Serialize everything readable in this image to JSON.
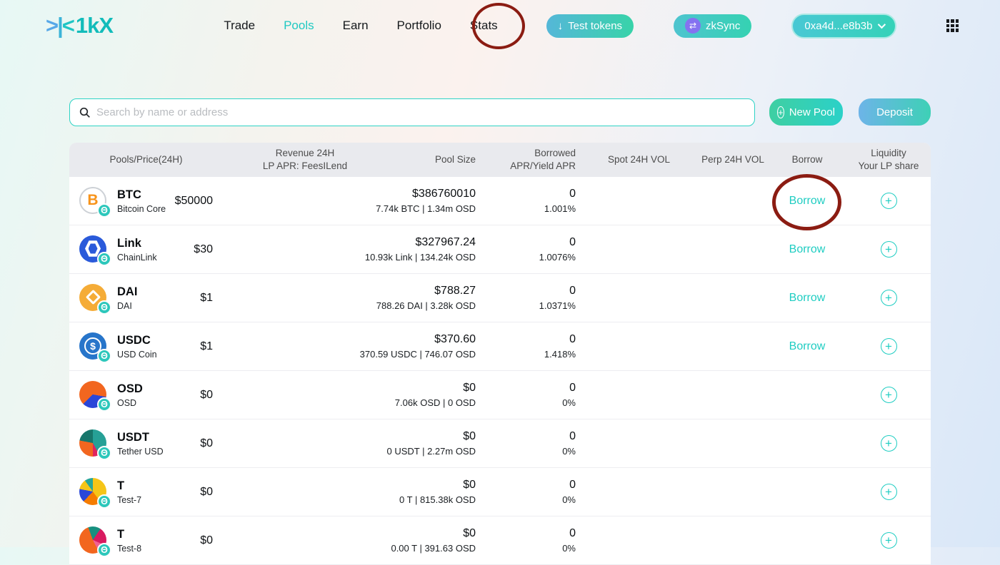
{
  "brand": {
    "mark_1": ">",
    "mark_2": "|",
    "mark_3": "<",
    "name": "1kX"
  },
  "nav": {
    "items": [
      {
        "label": "Trade"
      },
      {
        "label": "Pools"
      },
      {
        "label": "Earn"
      },
      {
        "label": "Portfolio"
      },
      {
        "label": "Stats"
      }
    ],
    "active": "Pools"
  },
  "header_actions": {
    "test_tokens": {
      "icon": "↓",
      "label": "Test tokens"
    },
    "network": {
      "icon": "⇄",
      "label": "zkSync"
    },
    "wallet": {
      "label": "0xa4d...e8b3b"
    }
  },
  "toolbar": {
    "search_placeholder": "Search by name or address",
    "new_pool_icon": "+",
    "new_pool_label": "New Pool",
    "deposit_label": "Deposit"
  },
  "table": {
    "columns": [
      {
        "line1": "Pools/Price(24H)",
        "line2": ""
      },
      {
        "line1": "Revenue 24H",
        "line2": "LP APR: FeesILend"
      },
      {
        "line1": "Pool Size",
        "line2": ""
      },
      {
        "line1": "Borrowed",
        "line2": "APR/Yield APR"
      },
      {
        "line1": "Spot 24H VOL",
        "line2": ""
      },
      {
        "line1": "Perp 24H VOL",
        "line2": ""
      },
      {
        "line1": "Borrow",
        "line2": ""
      },
      {
        "line1": "Liquidity",
        "line2": "Your LP share"
      }
    ],
    "badge_glyph": "Θ",
    "plus_icon": "+",
    "rows": [
      {
        "symbol": "BTC",
        "name": "Bitcoin Core",
        "price": "$50000",
        "pool_size": "$386760010",
        "pool_detail": "7.74k BTC | 1.34m OSD",
        "borrowed": "0",
        "apr": "1.001%",
        "borrow_label": "Borrow",
        "icon": {
          "style": "btc",
          "glyph": "B"
        }
      },
      {
        "symbol": "Link",
        "name": "ChainLink",
        "price": "$30",
        "pool_size": "$327967.24",
        "pool_detail": "10.93k Link | 134.24k OSD",
        "borrowed": "0",
        "apr": "1.0076%",
        "borrow_label": "Borrow",
        "icon": {
          "style": "link",
          "bg": "#2a5ada"
        }
      },
      {
        "symbol": "DAI",
        "name": "DAI",
        "price": "$1",
        "pool_size": "$788.27",
        "pool_detail": "788.26 DAI | 3.28k OSD",
        "borrowed": "0",
        "apr": "1.0371%",
        "borrow_label": "Borrow",
        "icon": {
          "style": "dai",
          "bg": "#f5ac37"
        }
      },
      {
        "symbol": "USDC",
        "name": "USD Coin",
        "price": "$1",
        "pool_size": "$370.60",
        "pool_detail": "370.59 USDC | 746.07 OSD",
        "borrowed": "0",
        "apr": "1.418%",
        "borrow_label": "Borrow",
        "icon": {
          "style": "usdc",
          "bg": "#2775ca",
          "glyph": "$"
        }
      },
      {
        "symbol": "OSD",
        "name": "OSD",
        "price": "$0",
        "pool_size": "$0",
        "pool_detail": "7.06k OSD | 0 OSD",
        "borrowed": "0",
        "apr": "0%",
        "borrow_label": "",
        "icon": {
          "style": "pie",
          "from": 100,
          "segments": [
            [
              "#2946d8",
              35
            ],
            [
              "#f2661f",
              65
            ]
          ]
        }
      },
      {
        "symbol": "USDT",
        "name": "Tether USD",
        "price": "$0",
        "pool_size": "$0",
        "pool_detail": "0 USDT | 2.27m OSD",
        "borrowed": "0",
        "apr": "0%",
        "borrow_label": "",
        "icon": {
          "style": "pie",
          "from": 0,
          "segments": [
            [
              "#26a096",
              42
            ],
            [
              "#e0245e",
              8
            ],
            [
              "#f2661f",
              28
            ],
            [
              "#17766b",
              22
            ]
          ]
        }
      },
      {
        "symbol": "T",
        "name": "Test-7",
        "price": "$0",
        "pool_size": "$0",
        "pool_detail": "0 T | 815.38k OSD",
        "borrowed": "0",
        "apr": "0%",
        "borrow_label": "",
        "icon": {
          "style": "pie",
          "from": 0,
          "segments": [
            [
              "#f5c518",
              40
            ],
            [
              "#f57c00",
              22
            ],
            [
              "#2946d8",
              16
            ],
            [
              "#f5c518",
              12
            ],
            [
              "#26a69a",
              10
            ]
          ]
        }
      },
      {
        "symbol": "T",
        "name": "Test-8",
        "price": "$0",
        "pool_size": "$0",
        "pool_detail": "0.00 T | 391.63 OSD",
        "borrowed": "0",
        "apr": "0%",
        "borrow_label": "",
        "icon": {
          "style": "pie",
          "from": 340,
          "segments": [
            [
              "#17907f",
              15
            ],
            [
              "#d81b60",
              22
            ],
            [
              "#f06292",
              11
            ],
            [
              "#f2661f",
              52
            ]
          ]
        }
      }
    ]
  },
  "colors": {
    "accent_teal": "#1fc9c2",
    "annotation_circle": "#8b1c12",
    "header_bg": "#e9eaee",
    "btc_orange": "#f7931a",
    "link_blue": "#2a5ada",
    "dai_gold": "#f5ac37",
    "usdc_blue": "#2775ca",
    "badge_teal": "#2cc7bb",
    "button_gradient_start": "#55b7d8",
    "button_gradient_end": "#38d3a9"
  }
}
